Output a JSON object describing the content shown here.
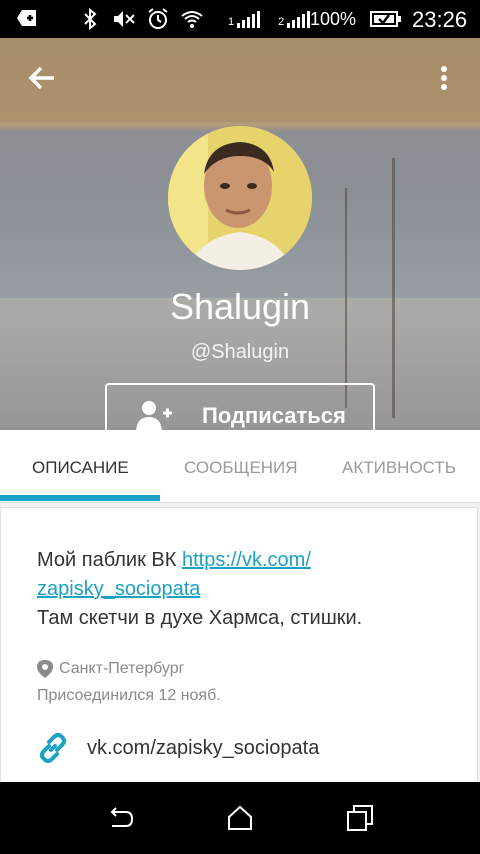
{
  "status_bar": {
    "sim1_label": "1",
    "sim2_label": "2",
    "battery_percent": "100%",
    "time": "23:26"
  },
  "profile": {
    "name": "Shalugin",
    "handle": "@Shalugin",
    "subscribe_label": "Подписаться"
  },
  "tabs": [
    {
      "label": "ОПИСАНИЕ",
      "active": true
    },
    {
      "label": "СООБЩЕНИЯ",
      "active": false
    },
    {
      "label": "АКТИВНОСТЬ",
      "active": false
    }
  ],
  "about": {
    "line1_prefix": "Мой паблик ВК ",
    "line1_link_part1": "https://vk.com/",
    "line1_link_part2": "zapisky_sociopata",
    "line2": "Там скетчи в духе Хармса, стишки.",
    "location": "Санкт-Петербург",
    "joined": "Присоединился 12 нояб.",
    "website": "vk.com/zapisky_sociopata"
  },
  "colors": {
    "accent": "#1ba1c4",
    "text": "#333333",
    "muted": "#8a8a8a"
  }
}
